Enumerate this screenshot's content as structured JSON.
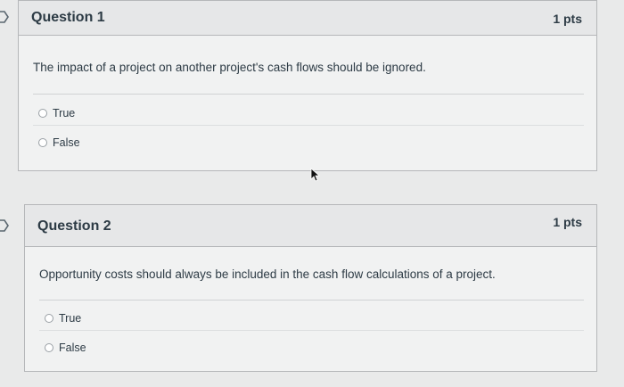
{
  "questions": [
    {
      "title": "Question 1",
      "points": "1 pts",
      "text": "The impact of a project on another project's cash flows should be ignored.",
      "answers": [
        {
          "label": "True",
          "selected": false
        },
        {
          "label": "False",
          "selected": false
        }
      ]
    },
    {
      "title": "Question 2",
      "points": "1 pts",
      "text": "Opportunity costs should always be included in the cash flow calculations of a project.",
      "answers": [
        {
          "label": "True",
          "selected": false
        },
        {
          "label": "False",
          "selected": false
        }
      ]
    }
  ],
  "icons": {
    "flag": "flag-question-icon",
    "radio": "radio-button-icon",
    "cursor": "mouse-pointer-icon"
  }
}
